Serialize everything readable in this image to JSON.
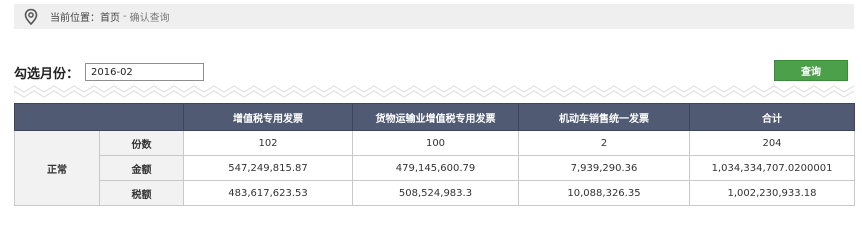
{
  "breadcrumb": {
    "location_label": "当前位置：",
    "home": "首页",
    "separator": "-",
    "current": "确认查询"
  },
  "filter": {
    "label": "勾选月份：",
    "month_value": "2016-02"
  },
  "actions": {
    "query_label": "查询"
  },
  "table": {
    "columns": [
      "",
      "增值税专用发票",
      "货物运输业增值税专用发票",
      "机动车销售统一发票",
      "合计"
    ],
    "group_label": "正常",
    "rows": [
      {
        "label": "份数",
        "values": [
          "102",
          "100",
          "2",
          "204"
        ]
      },
      {
        "label": "金额",
        "values": [
          "547,249,815.87",
          "479,145,600.79",
          "7,939,290.36",
          "1,034,334,707.0200001"
        ]
      },
      {
        "label": "税额",
        "values": [
          "483,617,623.53",
          "508,524,983.3",
          "10,088,326.35",
          "1,002,230,933.18"
        ]
      }
    ]
  },
  "colors": {
    "header_bg": "#505a73",
    "query_button": "#4ca04a",
    "breadcrumb_bg": "#efefef"
  },
  "icons": {
    "location": "map-pin-icon"
  }
}
